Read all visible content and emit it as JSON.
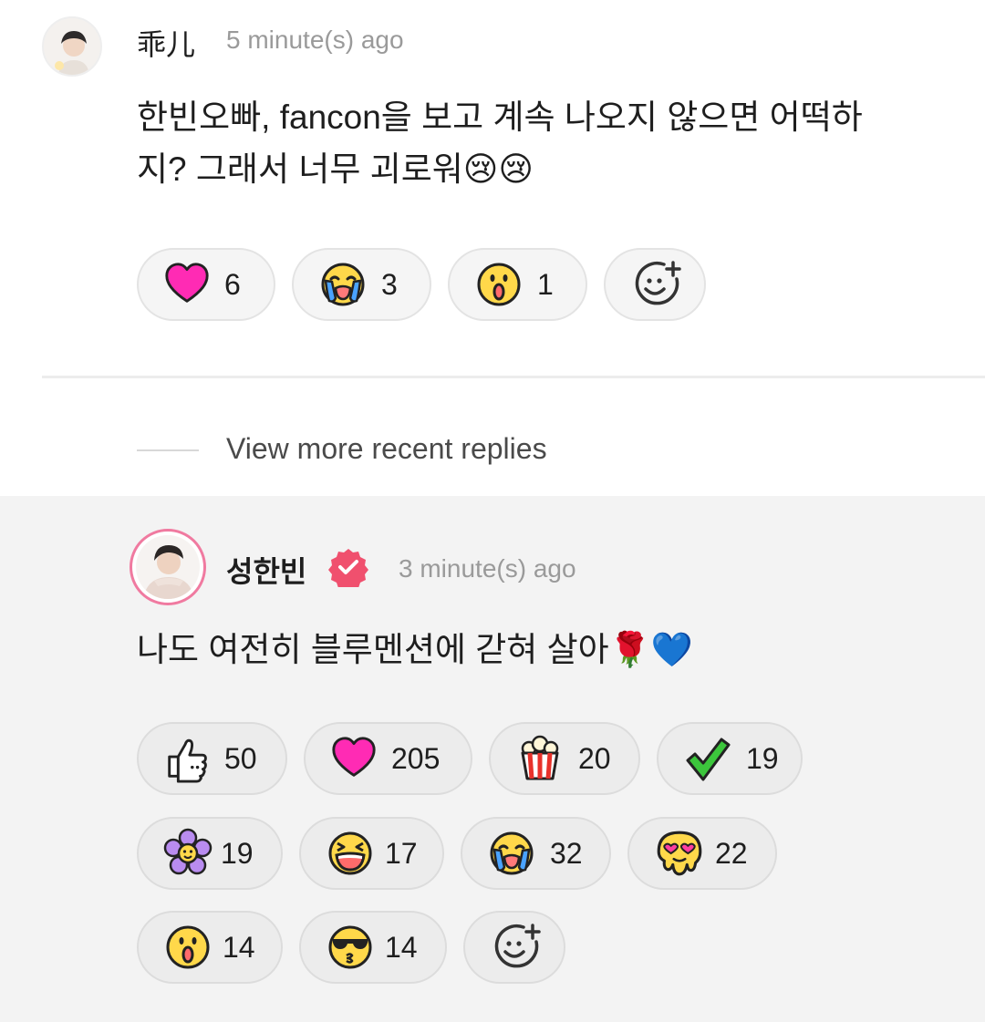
{
  "comment": {
    "username": "乖儿",
    "time": "5 minute(s) ago",
    "text_line1": "한빈오빠, fancon을 보고 계속 나오지 않으면 어떡하",
    "text_line2": "지? 그래서 너무 괴로워😢😢",
    "reactions": [
      {
        "icon": "heart-icon",
        "count": "6"
      },
      {
        "icon": "crying-face-icon",
        "count": "3"
      },
      {
        "icon": "surprised-face-icon",
        "count": "1"
      }
    ],
    "add_reaction_icon": "add-reaction-icon"
  },
  "view_more": "View more recent replies",
  "reply": {
    "username": "성한빈",
    "verified_color": "#f0506e",
    "time": "3 minute(s) ago",
    "text": "나도 여전히 블루멘션에 갇혀 살아🌹💙",
    "reactions": [
      {
        "icon": "thumbs-up-icon",
        "count": "50"
      },
      {
        "icon": "heart-icon",
        "count": "205"
      },
      {
        "icon": "popcorn-icon",
        "count": "20"
      },
      {
        "icon": "checkmark-icon",
        "count": "19"
      },
      {
        "icon": "flower-icon",
        "count": "19"
      },
      {
        "icon": "laughing-face-icon",
        "count": "17"
      },
      {
        "icon": "crying-face-icon",
        "count": "32"
      },
      {
        "icon": "melting-heart-eyes-icon",
        "count": "22"
      },
      {
        "icon": "surprised-face-icon",
        "count": "14"
      },
      {
        "icon": "sunglasses-kiss-face-icon",
        "count": "14"
      }
    ],
    "add_reaction_icon": "add-reaction-icon"
  },
  "colors": {
    "heart": "#ff2bb4",
    "verified": "#f0506e",
    "accent_pink": "#f07aa0"
  }
}
